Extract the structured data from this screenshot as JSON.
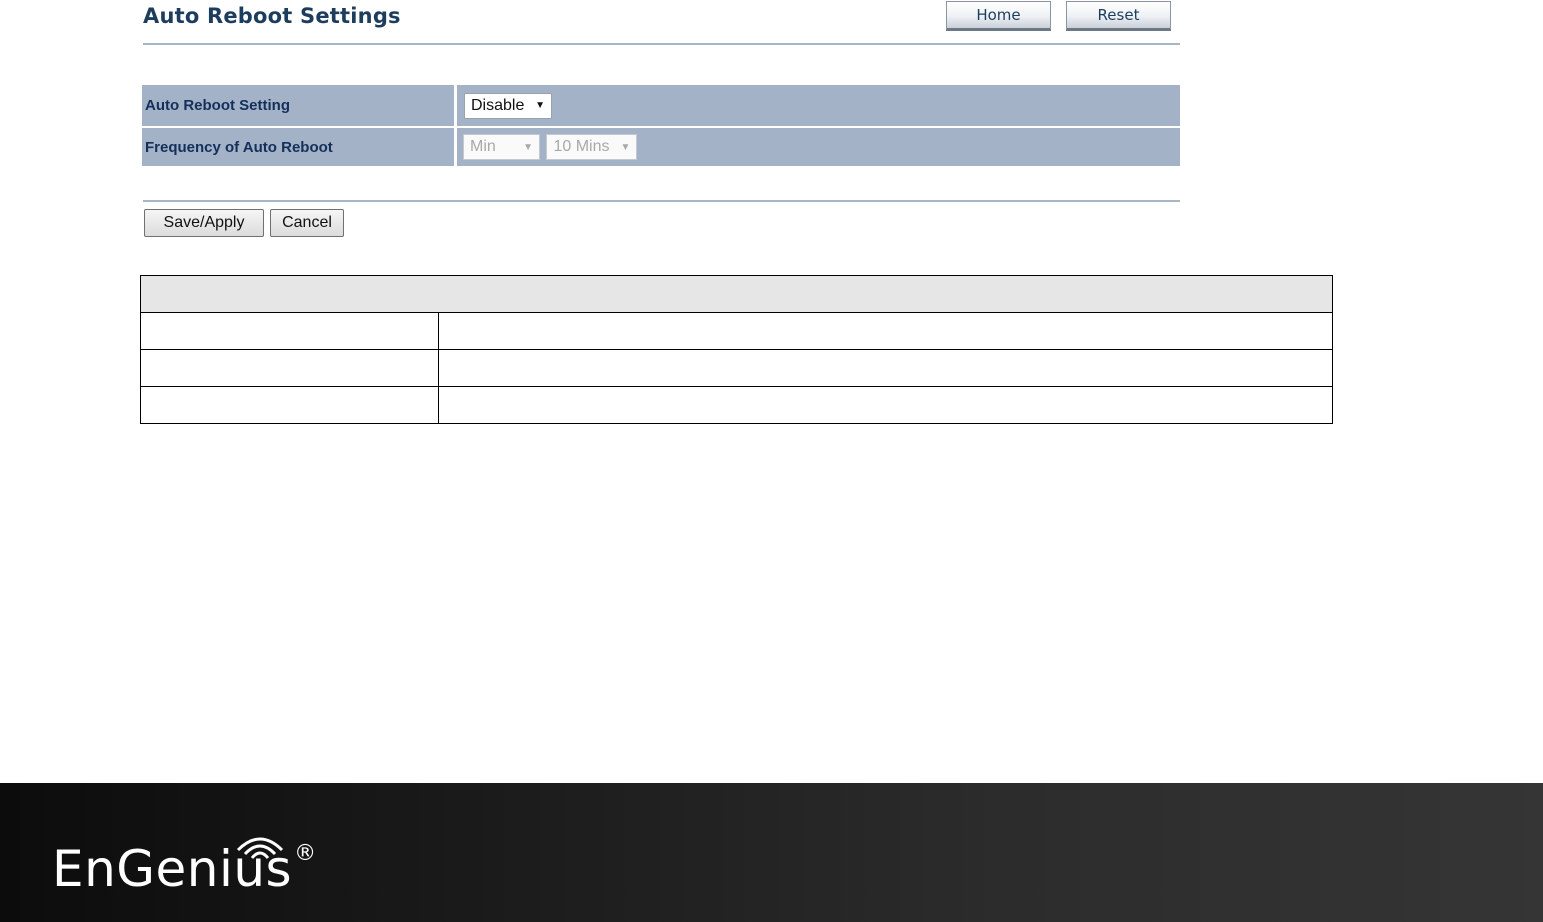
{
  "header": {
    "title": "Auto Reboot Settings",
    "home_label": "Home",
    "reset_label": "Reset"
  },
  "settings": {
    "rows": [
      {
        "label": "Auto Reboot Setting",
        "select": "Disable"
      },
      {
        "label": "Frequency of Auto Reboot",
        "unit_select": "Min",
        "interval_select": "10 Mins"
      }
    ]
  },
  "actions": {
    "save_label": "Save/Apply",
    "cancel_label": "Cancel"
  },
  "footer": {
    "brand": "EnGenius",
    "registered": "®"
  },
  "colors": {
    "row_background": "#a3b2c6",
    "label_text": "#14305a",
    "title_text": "#1d3d5e",
    "footer_dark": "#0c0c0c"
  },
  "icons": [
    "chevron-down-icon",
    "wifi-icon"
  ]
}
